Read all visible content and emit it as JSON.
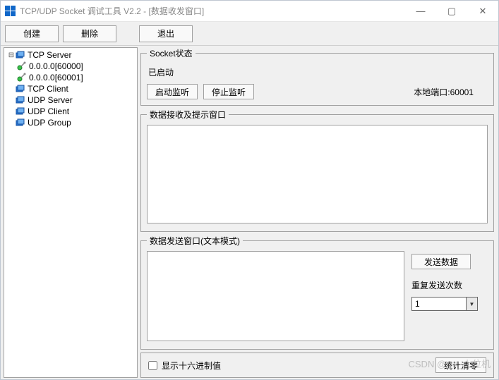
{
  "window": {
    "title": "TCP/UDP Socket 调试工具 V2.2 - [数据收发窗口]"
  },
  "sys": {
    "min": "—",
    "max": "▢",
    "close": "✕"
  },
  "toolbar": {
    "create": "创建",
    "delete": "删除",
    "exit": "退出"
  },
  "tree": {
    "items": [
      {
        "label": "TCP Server",
        "type": "root",
        "expanded": true
      },
      {
        "label": "0.0.0.0[60000]",
        "type": "node"
      },
      {
        "label": "0.0.0.0[60001]",
        "type": "node"
      },
      {
        "label": "TCP Client",
        "type": "root"
      },
      {
        "label": "UDP Server",
        "type": "root"
      },
      {
        "label": "UDP Client",
        "type": "root"
      },
      {
        "label": "UDP Group",
        "type": "root"
      }
    ]
  },
  "status": {
    "legend": "Socket状态",
    "text": "已启动",
    "start_btn": "启动监听",
    "stop_btn": "停止监听",
    "port_label": "本地端口:60001"
  },
  "recv": {
    "legend": "数据接收及提示窗口",
    "value": ""
  },
  "send": {
    "legend": "数据发送窗口(文本模式)",
    "value": "",
    "send_btn": "发送数据",
    "repeat_label": "重复发送次数",
    "repeat_value": "1"
  },
  "bottom": {
    "hex_label": "显示十六进制值",
    "clear_btn": "统计清零"
  },
  "watermark": "CSDN @C#_上位机"
}
